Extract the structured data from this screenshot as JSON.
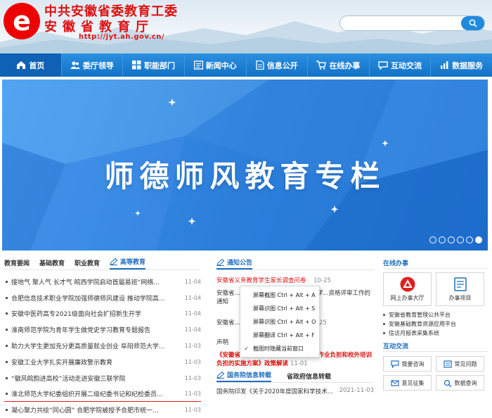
{
  "header": {
    "logo_glyph": "e",
    "title_cn": "中共安徽省委教育工委",
    "title_sub": "安徽省教育厅",
    "url": "http://jyt.ah.gov.cn/",
    "search_placeholder": ""
  },
  "nav": {
    "items": [
      {
        "label": "首页",
        "icon": "home-icon"
      },
      {
        "label": "委厅领导",
        "icon": "users-icon"
      },
      {
        "label": "职能部门",
        "icon": "grid-icon"
      },
      {
        "label": "新闻中心",
        "icon": "news-icon"
      },
      {
        "label": "信息公开",
        "icon": "doc-icon"
      },
      {
        "label": "在线办事",
        "icon": "cart-icon"
      },
      {
        "label": "互动交流",
        "icon": "chat-icon"
      },
      {
        "label": "数据服务",
        "icon": "data-icon"
      }
    ]
  },
  "banner": {
    "text": "师德师风教育专栏",
    "dot_count": 6,
    "active_dot": 6
  },
  "education_news": {
    "tabs": [
      "教育要闻",
      "基础教育",
      "职业教育",
      "高等教育"
    ],
    "active_tab": "高等教育",
    "items": [
      {
        "title": "接地气 聚人气 长才气 皖西学院启动首届易班“网络...",
        "date": "11-04"
      },
      {
        "title": "合肥信息技术职业学院加强师德师风建设 推动学院高...",
        "date": "11-04"
      },
      {
        "title": "安徽中医药高专2021级面向社会扩招新生开学",
        "date": "11-04"
      },
      {
        "title": "淮南师范学院为青年学生做党史学习教育专题报告",
        "date": "11-04"
      },
      {
        "title": "助力大学生更加充分更高质量就业创业 阜阳师范大学...",
        "date": "11-03"
      },
      {
        "title": "安徽工业大学扎实开展廉政警示教育",
        "date": "11-03"
      },
      {
        "title": "“徽风皖韵进高校”活动走进安徽三联学院",
        "date": "11-03"
      },
      {
        "title": "淮北师范大学纪委组织开展二级纪委书记和纪检委员...",
        "date": "11-03"
      },
      {
        "title": "凝心聚力共绘“同心圆” 合肥学院被授予合肥市统一...",
        "date": "11-03"
      }
    ]
  },
  "notices": {
    "title": "通知公告",
    "items": [
      {
        "text": "安徽省义务教育学生家长调查问卷",
        "date": "10-25",
        "red": true
      },
      {
        "text": "安徽省... 教育厅关于做好2021年中小学...资格评审工作的通知",
        "date": "",
        "red": false
      },
      {
        "text": "安徽省... 教育大会精神主题征文...",
        "date": "10-25",
        "red": false
      },
      {
        "text": "声明",
        "date": "",
        "red": false
      },
      {
        "text": "《安徽省进一步减轻义务教育阶段学生作业负担和校外培训负担的实施方案》政策解读",
        "date": "11-01",
        "red": true
      }
    ],
    "tabs": [
      "国务院信息转载",
      "省政府信息转载"
    ],
    "last_item": {
      "text": "国务院印发《关于2020年度国家科学技术...",
      "date": "2021-11-03"
    }
  },
  "context_menu": {
    "items": [
      "屏幕截图 Ctrl + Alt + A",
      "屏幕识图 Ctrl + Alt + S",
      "屏幕识图 Ctrl + Alt + O",
      "屏幕翻译 Ctrl + Alt + F",
      "截图时隐藏当前窗口"
    ],
    "checked_index": 4
  },
  "online_service": {
    "title": "在线办事",
    "boxes": [
      {
        "label": "网上办事大厅",
        "icon": "gov-hall-icon"
      },
      {
        "label": "办事项目",
        "icon": "project-icon"
      }
    ],
    "links": [
      "安徽省教育管理公共平台",
      "安徽基础教育资源应用平台",
      "信访月报表采集系统"
    ]
  },
  "interaction": {
    "title": "互动交流",
    "items": [
      {
        "label": "我要咨询",
        "icon": "chat-icon"
      },
      {
        "label": "常见问题",
        "icon": "faq-icon"
      },
      {
        "label": "意见征集",
        "icon": "mail-icon"
      },
      {
        "label": "数据查询",
        "icon": "query-icon"
      }
    ]
  },
  "colors": {
    "nav_blue": "#1f78c8",
    "brand_red": "#d11111",
    "accent_blue": "#1f6fbf"
  }
}
